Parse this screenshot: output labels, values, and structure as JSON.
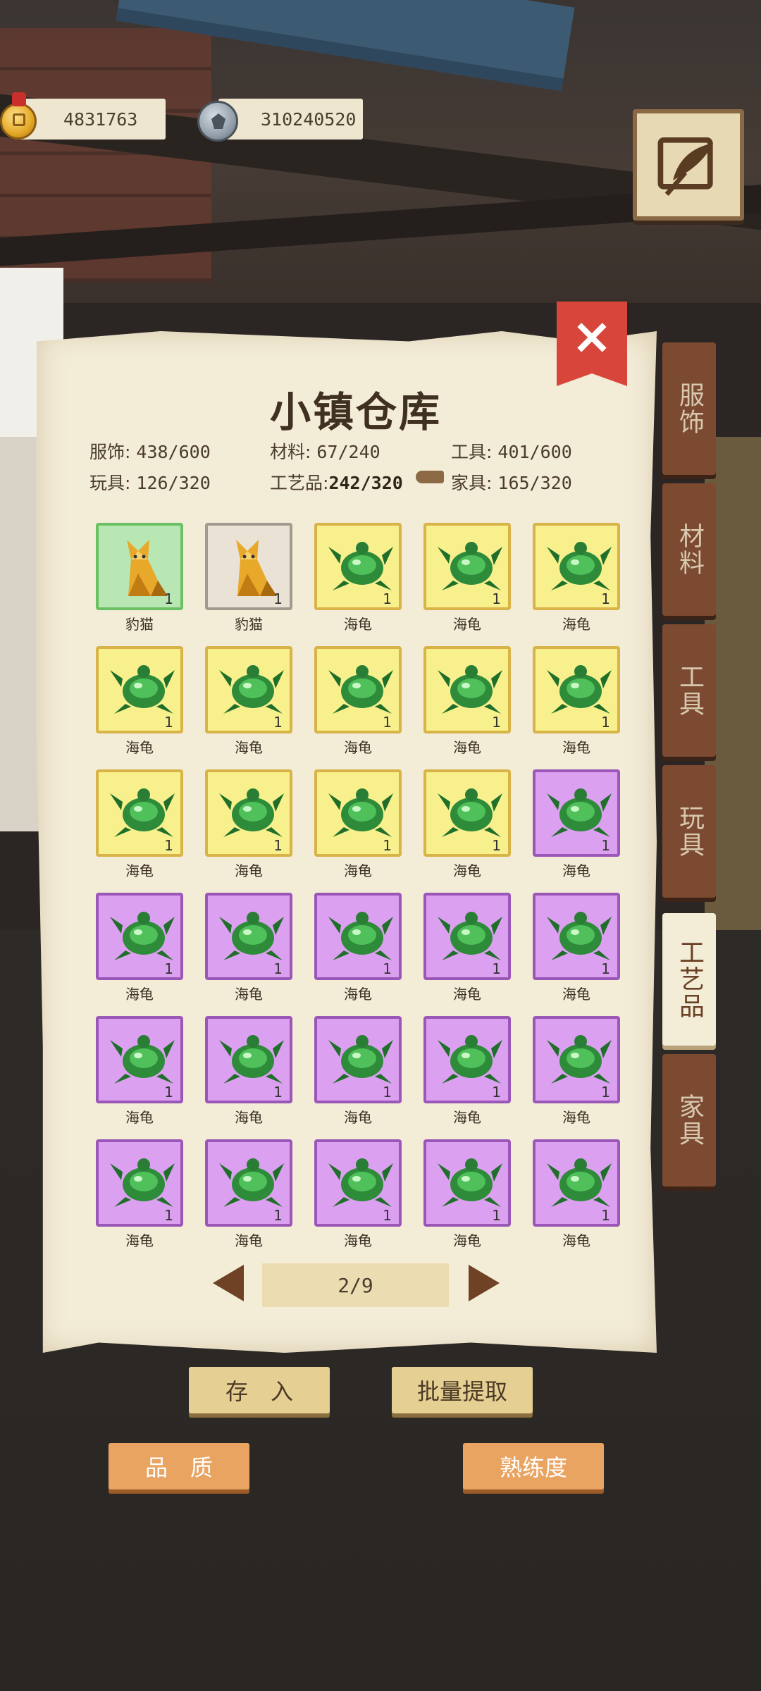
{
  "currency": {
    "gold": "4831763",
    "silver": "310240520"
  },
  "panel": {
    "title": "小镇仓库",
    "stats": [
      {
        "label": "服饰:",
        "value": "438/600",
        "bold": false
      },
      {
        "label": "材料:",
        "value": "67/240",
        "bold": false
      },
      {
        "label": "工具:",
        "value": "401/600",
        "bold": false
      },
      {
        "label": "玩具:",
        "value": "126/320",
        "bold": false
      },
      {
        "label": "工艺品:",
        "value": "242/320",
        "bold": true
      },
      {
        "label": "家具:",
        "value": "165/320",
        "bold": false
      }
    ]
  },
  "items": [
    {
      "name": "豹猫",
      "count": "1",
      "rarity": "green",
      "icon": "cat-icon"
    },
    {
      "name": "豹猫",
      "count": "1",
      "rarity": "grey",
      "icon": "cat-icon"
    },
    {
      "name": "海龟",
      "count": "1",
      "rarity": "yellow",
      "icon": "turtle-icon"
    },
    {
      "name": "海龟",
      "count": "1",
      "rarity": "yellow",
      "icon": "turtle-icon"
    },
    {
      "name": "海龟",
      "count": "1",
      "rarity": "yellow",
      "icon": "turtle-icon"
    },
    {
      "name": "海龟",
      "count": "1",
      "rarity": "yellow",
      "icon": "turtle-icon"
    },
    {
      "name": "海龟",
      "count": "1",
      "rarity": "yellow",
      "icon": "turtle-icon"
    },
    {
      "name": "海龟",
      "count": "1",
      "rarity": "yellow",
      "icon": "turtle-icon"
    },
    {
      "name": "海龟",
      "count": "1",
      "rarity": "yellow",
      "icon": "turtle-icon"
    },
    {
      "name": "海龟",
      "count": "1",
      "rarity": "yellow",
      "icon": "turtle-icon"
    },
    {
      "name": "海龟",
      "count": "1",
      "rarity": "yellow",
      "icon": "turtle-icon"
    },
    {
      "name": "海龟",
      "count": "1",
      "rarity": "yellow",
      "icon": "turtle-icon"
    },
    {
      "name": "海龟",
      "count": "1",
      "rarity": "yellow",
      "icon": "turtle-icon"
    },
    {
      "name": "海龟",
      "count": "1",
      "rarity": "yellow",
      "icon": "turtle-icon"
    },
    {
      "name": "海龟",
      "count": "1",
      "rarity": "purple",
      "icon": "turtle-icon"
    },
    {
      "name": "海龟",
      "count": "1",
      "rarity": "purple",
      "icon": "turtle-icon"
    },
    {
      "name": "海龟",
      "count": "1",
      "rarity": "purple",
      "icon": "turtle-icon"
    },
    {
      "name": "海龟",
      "count": "1",
      "rarity": "purple",
      "icon": "turtle-icon"
    },
    {
      "name": "海龟",
      "count": "1",
      "rarity": "purple",
      "icon": "turtle-icon"
    },
    {
      "name": "海龟",
      "count": "1",
      "rarity": "purple",
      "icon": "turtle-icon"
    },
    {
      "name": "海龟",
      "count": "1",
      "rarity": "purple",
      "icon": "turtle-icon"
    },
    {
      "name": "海龟",
      "count": "1",
      "rarity": "purple",
      "icon": "turtle-icon"
    },
    {
      "name": "海龟",
      "count": "1",
      "rarity": "purple",
      "icon": "turtle-icon"
    },
    {
      "name": "海龟",
      "count": "1",
      "rarity": "purple",
      "icon": "turtle-icon"
    },
    {
      "name": "海龟",
      "count": "1",
      "rarity": "purple",
      "icon": "turtle-icon"
    },
    {
      "name": "海龟",
      "count": "1",
      "rarity": "purple",
      "icon": "turtle-icon"
    },
    {
      "name": "海龟",
      "count": "1",
      "rarity": "purple",
      "icon": "turtle-icon"
    },
    {
      "name": "海龟",
      "count": "1",
      "rarity": "purple",
      "icon": "turtle-icon"
    },
    {
      "name": "海龟",
      "count": "1",
      "rarity": "purple",
      "icon": "turtle-icon"
    },
    {
      "name": "海龟",
      "count": "1",
      "rarity": "purple",
      "icon": "turtle-icon"
    }
  ],
  "pager": {
    "label": "2/9"
  },
  "tabs": [
    {
      "label": "服饰",
      "active": false
    },
    {
      "label": "材料",
      "active": false
    },
    {
      "label": "工具",
      "active": false
    },
    {
      "label": "玩具",
      "active": false
    },
    {
      "label": "工艺品",
      "active": true
    },
    {
      "label": "家具",
      "active": false
    }
  ],
  "buttons": {
    "deposit": "存　入",
    "batch_extract": "批量提取",
    "quality": "品　质",
    "proficiency": "熟练度"
  },
  "colors": {
    "rarity_green": "#b8e7b3",
    "rarity_grey": "#e9e2d5",
    "rarity_yellow": "#f7f08c",
    "rarity_purple": "#dca0f0",
    "close_red": "#d8453a",
    "tab_brown": "#7b4a31"
  }
}
